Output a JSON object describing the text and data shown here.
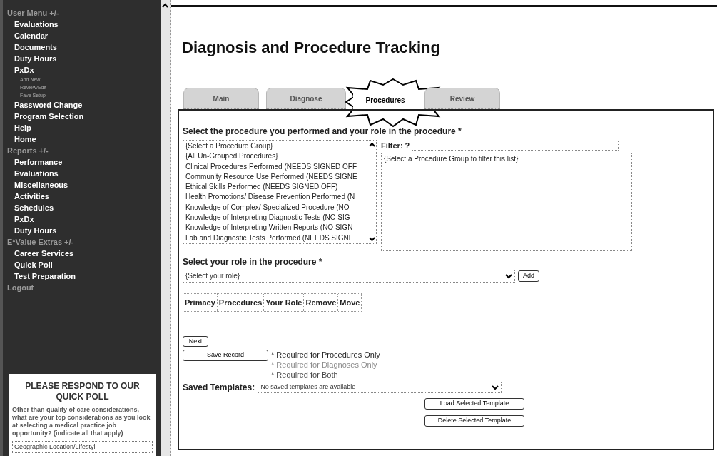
{
  "sidebar": {
    "items": [
      {
        "kind": "header",
        "label": "User Menu +/-"
      },
      {
        "kind": "item",
        "label": "Evaluations"
      },
      {
        "kind": "item",
        "label": "Calendar"
      },
      {
        "kind": "item",
        "label": "Documents"
      },
      {
        "kind": "item",
        "label": "Duty Hours"
      },
      {
        "kind": "item",
        "label": "PxDx"
      },
      {
        "kind": "subitem",
        "label": "Add New"
      },
      {
        "kind": "subitem",
        "label": "Review/Edit"
      },
      {
        "kind": "subitem",
        "label": "Fave Setup"
      },
      {
        "kind": "item",
        "label": "Password Change"
      },
      {
        "kind": "item",
        "label": "Program Selection"
      },
      {
        "kind": "item",
        "label": "Help"
      },
      {
        "kind": "item",
        "label": "Home"
      },
      {
        "kind": "header",
        "label": "Reports +/-"
      },
      {
        "kind": "item",
        "label": "Performance"
      },
      {
        "kind": "item",
        "label": "Evaluations"
      },
      {
        "kind": "item",
        "label": "Miscellaneous"
      },
      {
        "kind": "item",
        "label": "Activities"
      },
      {
        "kind": "item",
        "label": "Schedules"
      },
      {
        "kind": "item",
        "label": "PxDx"
      },
      {
        "kind": "item",
        "label": "Duty Hours"
      },
      {
        "kind": "header",
        "label": "E*Value Extras +/-"
      },
      {
        "kind": "item",
        "label": "Career Services"
      },
      {
        "kind": "item",
        "label": "Quick Poll"
      },
      {
        "kind": "item",
        "label": "Test Preparation"
      },
      {
        "kind": "header",
        "label": "Logout"
      }
    ],
    "poll": {
      "title": "PLEASE RESPOND TO OUR QUICK POLL",
      "question": "Other than quality of care considerations, what are your top considerations as you look at selecting a medical practice job opportunity? (indicate all that apply)",
      "option": "Geographic Location/Lifestyl"
    }
  },
  "page": {
    "title": "Diagnosis and Procedure Tracking",
    "tabs": [
      {
        "label": "Main",
        "selected": false
      },
      {
        "label": "Diagnose",
        "selected": false
      },
      {
        "label": "Procedures",
        "selected": true
      },
      {
        "label": "Review",
        "selected": false
      }
    ]
  },
  "form": {
    "procedure_prompt": "Select the procedure you performed and your role in the procedure *",
    "procedure_groups": [
      "{Select a Procedure Group}",
      "{All Un-Grouped Procedures}",
      "Clinical Procedures Performed (NEEDS SIGNED OFF",
      "Community Resource Use Performed (NEEDS SIGNE",
      "Ethical Skills Performed (NEEDS SIGNED OFF)",
      "Health Promotions/ Disease Prevention Performed (N",
      "Knowledge of Complex/ Specialized Procedure (NO",
      "Knowledge of Interpreting Diagnostic Tests (NO SIG",
      "Knowledge of Interpreting Written Reports (NO SIGN",
      "Lab and Diagnostic Tests Performed (NEEDS SIGNE"
    ],
    "filter_label": "Filter: ?",
    "procedures": [
      "{Select a Procedure Group to filter this list}"
    ],
    "role_prompt": "Select your role in the procedure *",
    "role_select": "{Select your role}",
    "add_button": "Add",
    "table": {
      "columns": [
        "Primacy",
        "Procedures",
        "Your Role",
        "Remove",
        "Move"
      ]
    },
    "next_button": "Next",
    "save_button": "Save Record",
    "legend": [
      {
        "text": "* Required for Procedures Only",
        "color": "#222222"
      },
      {
        "text": "* Required for Diagnoses Only",
        "color": "#8a8a8a"
      },
      {
        "text": "* Required for Both",
        "color": "#444444"
      }
    ],
    "templates_label": "Saved Templates:",
    "templates_select": "No saved templates are available",
    "load_button": "Load Selected Template",
    "delete_button": "Delete Selected Template"
  }
}
